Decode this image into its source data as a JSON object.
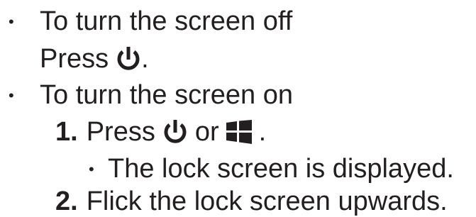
{
  "section_off": {
    "heading": "To turn the screen off",
    "press_label": "Press",
    "press_suffix": "."
  },
  "section_on": {
    "heading": "To turn the screen on",
    "steps": [
      {
        "number": "1.",
        "press_label": "Press",
        "or_label": "or",
        "suffix": ".",
        "sub_bullet": "The lock screen is displayed."
      },
      {
        "number": "2.",
        "text": "Flick the lock screen upwards."
      }
    ]
  },
  "icons": {
    "power": "power-icon",
    "windows": "windows-icon"
  },
  "colors": {
    "text": "#231f20"
  }
}
